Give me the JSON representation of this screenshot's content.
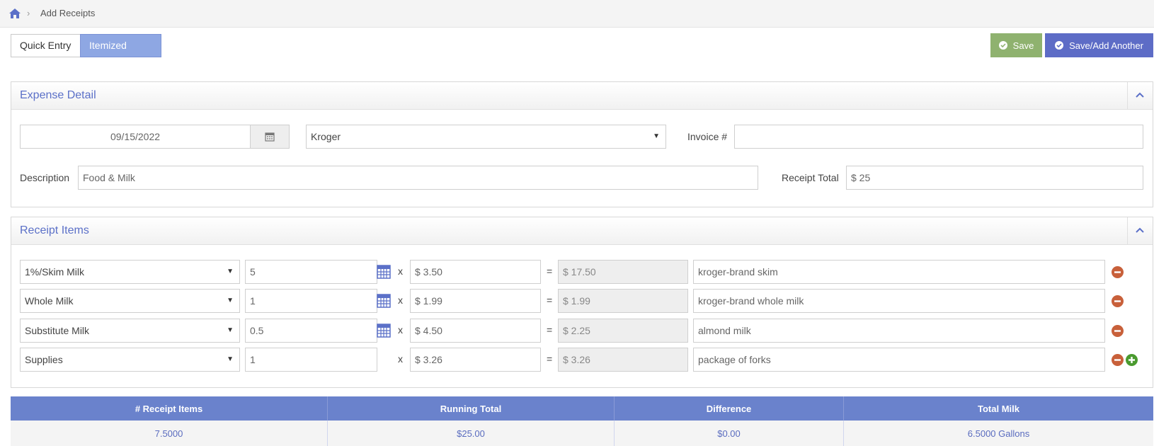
{
  "breadcrumb": {
    "current": "Add Receipts",
    "separator": "›"
  },
  "entry_mode": {
    "quick": "Quick Entry",
    "itemized": "Itemized Entry",
    "active": "itemized"
  },
  "actions": {
    "save": "Save",
    "save_another": "Save/Add Another"
  },
  "colors": {
    "accent": "#5b70c8",
    "save": "#8fb26f",
    "save_another": "#5d6cc6",
    "remove": "#c8603a",
    "add": "#4a9a2f"
  },
  "expense_detail": {
    "title": "Expense Detail",
    "date": "09/15/2022",
    "vendor": "Kroger",
    "invoice_label": "Invoice #",
    "invoice_value": "",
    "description_label": "Description",
    "description_value": "Food & Milk",
    "receipt_total_label": "Receipt Total",
    "receipt_total_value": "$ 25"
  },
  "receipt_items": {
    "title": "Receipt Items",
    "multiply": "x",
    "equals": "=",
    "rows": [
      {
        "category": "1%/Skim Milk",
        "qty": "5",
        "price": "$ 3.50",
        "total": "$ 17.50",
        "note": "kroger-brand skim"
      },
      {
        "category": "Whole Milk",
        "qty": "1",
        "price": "$ 1.99",
        "total": "$ 1.99",
        "note": "kroger-brand whole milk"
      },
      {
        "category": "Substitute Milk",
        "qty": "0.5",
        "price": "$ 4.50",
        "total": "$ 2.25",
        "note": "almond milk"
      },
      {
        "category": "Supplies",
        "qty": "1",
        "price": "$ 3.26",
        "total": "$ 3.26",
        "note": "package of forks"
      }
    ]
  },
  "summary": {
    "headers": [
      "# Receipt Items",
      "Running Total",
      "Difference",
      "Total Milk"
    ],
    "values": [
      "7.5000",
      "$25.00",
      "$0.00",
      "6.5000 Gallons"
    ]
  }
}
